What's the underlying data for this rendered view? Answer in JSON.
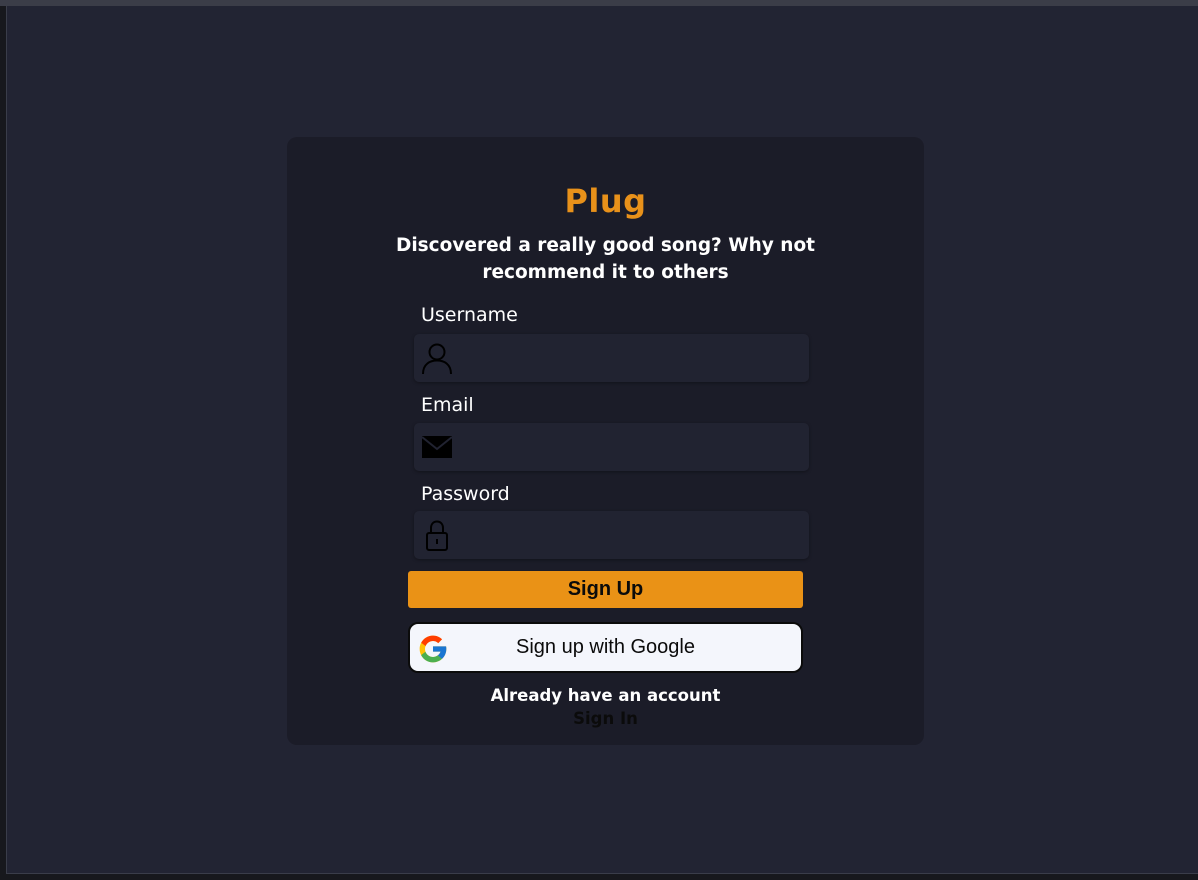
{
  "app": {
    "title": "Plug",
    "tagline": "Discovered a really good song? Why not recommend it to others"
  },
  "form": {
    "fields": [
      {
        "label": "Username",
        "icon": "user-icon",
        "value": "",
        "placeholder": ""
      },
      {
        "label": "Email",
        "icon": "mail-icon",
        "value": "",
        "placeholder": ""
      },
      {
        "label": "Password",
        "icon": "lock-icon",
        "value": "",
        "placeholder": ""
      }
    ],
    "submit_label": "Sign Up",
    "google_label": "Sign up with Google",
    "google_icon": "google-icon"
  },
  "footer": {
    "prompt": "Already have an account",
    "link_label": "Sign In"
  },
  "colors": {
    "accent": "#ea9216",
    "background": "#222433",
    "card": "#1b1c28",
    "field": "#212331",
    "google_button": "#f4f6fc"
  }
}
